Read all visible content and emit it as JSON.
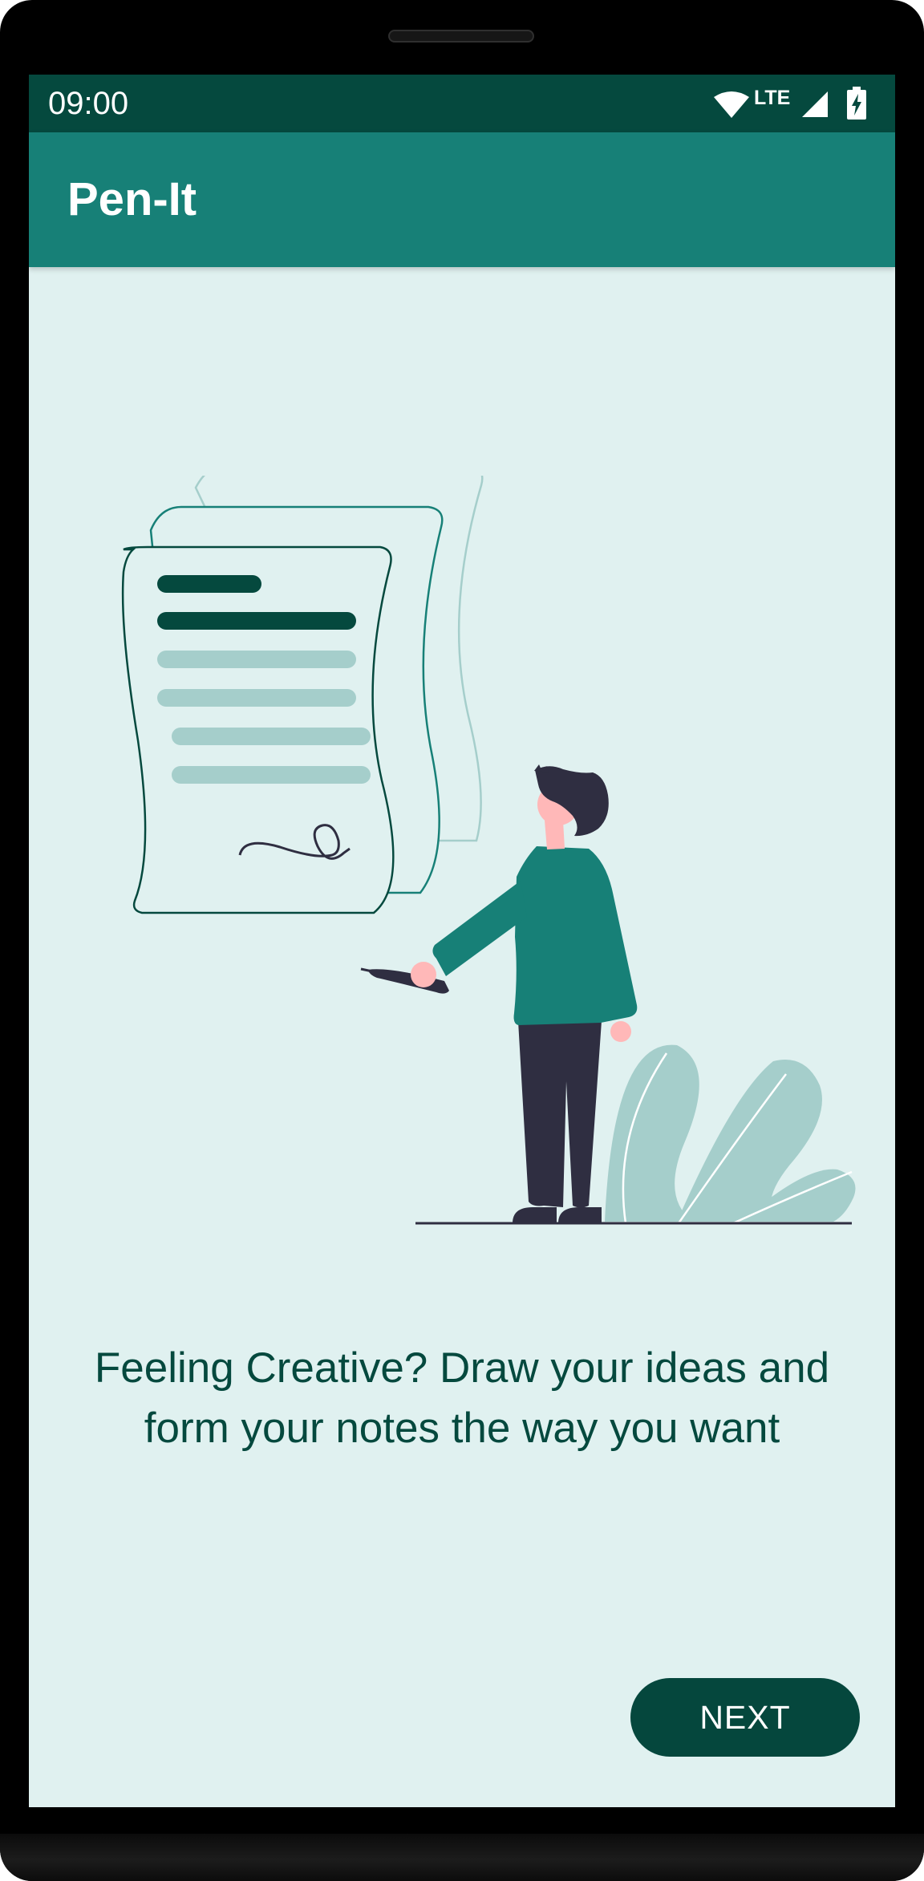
{
  "status_bar": {
    "time": "09:00",
    "network_label": "LTE",
    "icons": [
      "wifi-icon",
      "cell-signal-icon",
      "battery-charging-icon"
    ]
  },
  "app_bar": {
    "title": "Pen-It"
  },
  "onboarding": {
    "illustration": "person-signing-document-illustration",
    "message": "Feeling Creative? Draw your ideas and form your notes the way you want",
    "next_label": "NEXT"
  },
  "colors": {
    "status_bar": "#05493e",
    "app_bar": "#178077",
    "background": "#e0f1f0",
    "text_primary": "#05493e",
    "button": "#05473d",
    "illustration_accent": "#178077",
    "illustration_light": "#a5cecb",
    "illustration_dark": "#2f2e41",
    "skin": "#ffb8b8"
  }
}
